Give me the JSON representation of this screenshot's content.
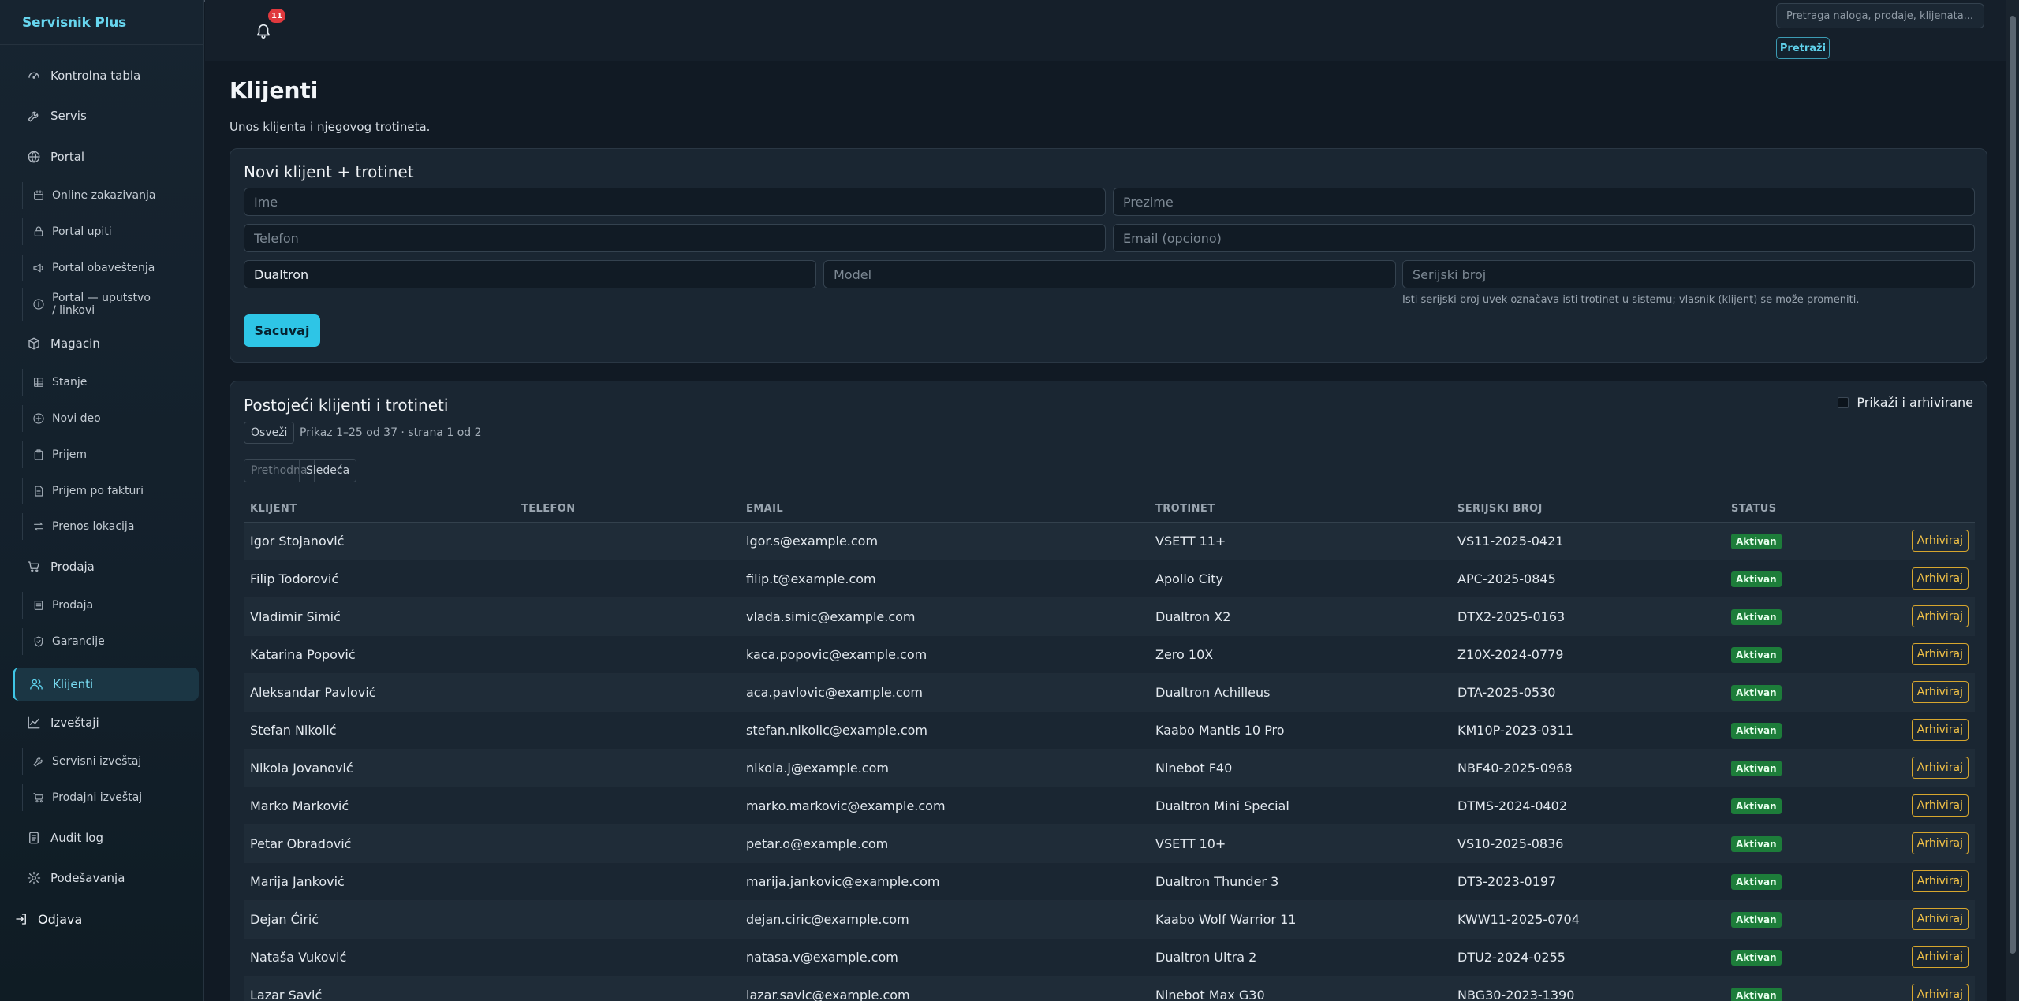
{
  "app": {
    "brand": "Servisnik Plus"
  },
  "sidebar": {
    "items": [
      {
        "label": "Kontrolna tabla",
        "icon": "dashboard-icon"
      },
      {
        "label": "Servis",
        "icon": "wrench-icon"
      },
      {
        "label": "Portal",
        "icon": "globe-icon"
      },
      {
        "label": "Online zakazivanja",
        "icon": "calendar-icon"
      },
      {
        "label": "Portal upiti",
        "icon": "lock-icon"
      },
      {
        "label": "Portal obaveštenja",
        "icon": "megaphone-icon"
      },
      {
        "label": "Portal — uputstvo / linkovi",
        "icon": "info-icon"
      },
      {
        "label": "Magacin",
        "icon": "box-icon"
      },
      {
        "label": "Stanje",
        "icon": "table-icon"
      },
      {
        "label": "Novi deo",
        "icon": "plus-circle-icon"
      },
      {
        "label": "Prijem",
        "icon": "clipboard-icon"
      },
      {
        "label": "Prijem po fakturi",
        "icon": "document-icon"
      },
      {
        "label": "Prenos lokacija",
        "icon": "transfer-icon"
      },
      {
        "label": "Prodaja",
        "icon": "cart-icon"
      },
      {
        "label": "Prodaja",
        "icon": "receipt-icon"
      },
      {
        "label": "Garancije",
        "icon": "shield-icon"
      },
      {
        "label": "Klijenti",
        "icon": "users-icon"
      },
      {
        "label": "Izveštaji",
        "icon": "chart-icon"
      },
      {
        "label": "Servisni izveštaj",
        "icon": "wrench-icon"
      },
      {
        "label": "Prodajni izveštaj",
        "icon": "cart-icon"
      },
      {
        "label": "Audit log",
        "icon": "log-icon"
      },
      {
        "label": "Podešavanja",
        "icon": "gear-icon"
      },
      {
        "label": "Odjava",
        "icon": "logout-icon"
      }
    ]
  },
  "header": {
    "notification_count": "11",
    "search_placeholder": "Pretraga naloga, prodaje, klijenata...",
    "search_button": "Pretraži"
  },
  "page": {
    "title": "Klijenti",
    "subtitle": "Unos klijenta i njegovog trotineta."
  },
  "form": {
    "title": "Novi klijent + trotinet",
    "first_name_placeholder": "Ime",
    "last_name_placeholder": "Prezime",
    "phone_placeholder": "Telefon",
    "email_placeholder": "Email (opciono)",
    "brand_value": "Dualtron",
    "model_placeholder": "Model",
    "serial_placeholder": "Serijski broj",
    "serial_hint": "Isti serijski broj uvek označava isti trotinet u sistemu; vlasnik (klijent) se može promeniti.",
    "save_button": "Sacuvaj"
  },
  "list": {
    "title": "Postojeći klijenti i trotineti",
    "refresh_button": "Osveži",
    "summary": "Prikaz 1–25 od 37 · strana 1 od 2",
    "prev_button": "Prethodna",
    "next_button": "Sledeća",
    "show_archived_label": "Prikaži i arhivirane",
    "columns": [
      "KLIJENT",
      "TELEFON",
      "EMAIL",
      "TROTINET",
      "SERIJSKI BROJ",
      "STATUS"
    ],
    "rows": [
      {
        "client": "Igor Stojanović",
        "phone": "",
        "email": "igor.s@example.com",
        "scooter": "VSETT 11+",
        "serial": "VS11-2025-0421",
        "status": "Aktivan",
        "action": "Arhiviraj"
      },
      {
        "client": "Filip Todorović",
        "phone": "",
        "email": "filip.t@example.com",
        "scooter": "Apollo City",
        "serial": "APC-2025-0845",
        "status": "Aktivan",
        "action": "Arhiviraj"
      },
      {
        "client": "Vladimir Simić",
        "phone": "",
        "email": "vlada.simic@example.com",
        "scooter": "Dualtron X2",
        "serial": "DTX2-2025-0163",
        "status": "Aktivan",
        "action": "Arhiviraj"
      },
      {
        "client": "Katarina Popović",
        "phone": "",
        "email": "kaca.popovic@example.com",
        "scooter": "Zero 10X",
        "serial": "Z10X-2024-0779",
        "status": "Aktivan",
        "action": "Arhiviraj"
      },
      {
        "client": "Aleksandar Pavlović",
        "phone": "",
        "email": "aca.pavlovic@example.com",
        "scooter": "Dualtron Achilleus",
        "serial": "DTA-2025-0530",
        "status": "Aktivan",
        "action": "Arhiviraj"
      },
      {
        "client": "Stefan Nikolić",
        "phone": "",
        "email": "stefan.nikolic@example.com",
        "scooter": "Kaabo Mantis 10 Pro",
        "serial": "KM10P-2023-0311",
        "status": "Aktivan",
        "action": "Arhiviraj"
      },
      {
        "client": "Nikola Jovanović",
        "phone": "",
        "email": "nikola.j@example.com",
        "scooter": "Ninebot F40",
        "serial": "NBF40-2025-0968",
        "status": "Aktivan",
        "action": "Arhiviraj"
      },
      {
        "client": "Marko Marković",
        "phone": "",
        "email": "marko.markovic@example.com",
        "scooter": "Dualtron Mini Special",
        "serial": "DTMS-2024-0402",
        "status": "Aktivan",
        "action": "Arhiviraj"
      },
      {
        "client": "Petar Obradović",
        "phone": "",
        "email": "petar.o@example.com",
        "scooter": "VSETT 10+",
        "serial": "VS10-2025-0836",
        "status": "Aktivan",
        "action": "Arhiviraj"
      },
      {
        "client": "Marija Janković",
        "phone": "",
        "email": "marija.jankovic@example.com",
        "scooter": "Dualtron Thunder 3",
        "serial": "DT3-2023-0197",
        "status": "Aktivan",
        "action": "Arhiviraj"
      },
      {
        "client": "Dejan Ćirić",
        "phone": "",
        "email": "dejan.ciric@example.com",
        "scooter": "Kaabo Wolf Warrior 11",
        "serial": "KWW11-2025-0704",
        "status": "Aktivan",
        "action": "Arhiviraj"
      },
      {
        "client": "Nataša Vuković",
        "phone": "",
        "email": "natasa.v@example.com",
        "scooter": "Dualtron Ultra 2",
        "serial": "DTU2-2024-0255",
        "status": "Aktivan",
        "action": "Arhiviraj"
      },
      {
        "client": "Lazar Savić",
        "phone": "",
        "email": "lazar.savic@example.com",
        "scooter": "Ninebot Max G30",
        "serial": "NBG30-2023-1390",
        "status": "Aktivan",
        "action": "Arhiviraj"
      }
    ]
  }
}
